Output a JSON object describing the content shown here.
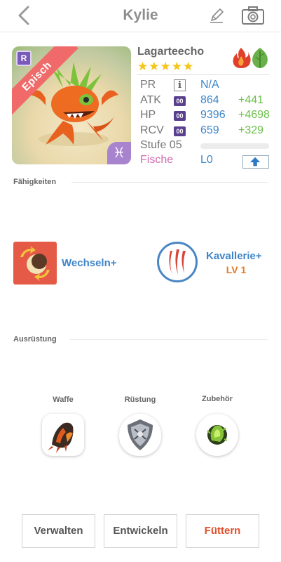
{
  "header": {
    "title": "Kylie",
    "back_icon": "chevron-left-icon",
    "edit_icon": "pencil-icon",
    "camera_icon": "camera-icon"
  },
  "monster": {
    "rarity_badge": "R",
    "rarity": "Episch",
    "zodiac": "♓",
    "name": "Lagarteecho",
    "stars": "★★★★★",
    "elements": [
      "fire-icon",
      "leaf-icon"
    ],
    "stats": {
      "pr": {
        "label": "PR",
        "value": "N/A"
      },
      "atk": {
        "label": "ATK",
        "badge": "00",
        "value": "864",
        "bonus": "+441"
      },
      "hp": {
        "label": "HP",
        "badge": "00",
        "value": "9396",
        "bonus": "+4698"
      },
      "rcv": {
        "label": "RCV",
        "badge": "00",
        "value": "659",
        "bonus": "+329"
      }
    },
    "level": {
      "label": "Stufe 05",
      "progress": 0
    },
    "fish": {
      "label": "Fische",
      "value": "L0"
    }
  },
  "skills": {
    "title": "Fähigkeiten",
    "items": [
      {
        "name": "Wechseln+"
      },
      {
        "name": "Kavallerie+",
        "level": "LV 1"
      }
    ]
  },
  "equipment": {
    "title": "Ausrüstung",
    "slots": [
      {
        "label": "Waffe"
      },
      {
        "label": "Rüstung"
      },
      {
        "label": "Zubehör"
      }
    ]
  },
  "actions": {
    "manage": "Verwalten",
    "evolve": "Entwickeln",
    "feed": "Füttern"
  },
  "colors": {
    "accent_blue": "#3e85c9",
    "bonus_green": "#6cc04a",
    "feed_red": "#e0502a",
    "fish_pink": "#d26ab2",
    "level_orange": "#e47a22"
  }
}
